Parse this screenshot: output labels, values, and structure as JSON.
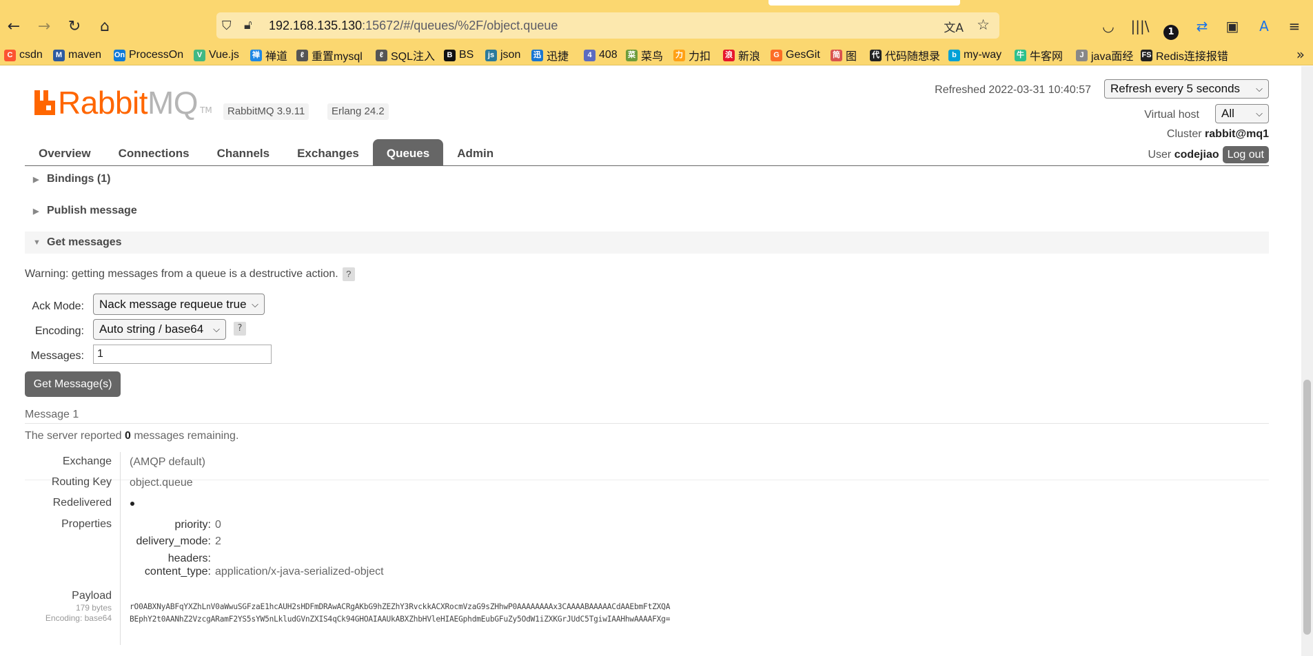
{
  "browser": {
    "url_host": "192.168.135.130",
    "url_rest": ":15672/#/queues/%2F/object.queue",
    "notification_count": "1"
  },
  "bookmarks": [
    {
      "label": "csdn",
      "color": "#fc5531",
      "glyph": "C"
    },
    {
      "label": "maven",
      "color": "#2c5aa0",
      "glyph": "M"
    },
    {
      "label": "ProcessOn",
      "color": "#0f7ad8",
      "glyph": "On"
    },
    {
      "label": "Vue.js",
      "color": "#41b883",
      "glyph": "V"
    },
    {
      "label": "禅道",
      "color": "#1e88e5",
      "glyph": "禅"
    },
    {
      "label": "重置mysql",
      "color": "#555555",
      "glyph": "ℓ"
    },
    {
      "label": "SQL注入",
      "color": "#555555",
      "glyph": "ℓ"
    },
    {
      "label": "BS",
      "color": "#111111",
      "glyph": "B"
    },
    {
      "label": "json",
      "color": "#2b7a9b",
      "glyph": "js"
    },
    {
      "label": "迅捷",
      "color": "#1976d2",
      "glyph": "迅"
    },
    {
      "label": "408",
      "color": "#5c6bc0",
      "glyph": "4"
    },
    {
      "label": "菜鸟",
      "color": "#6d9c3b",
      "glyph": "菜"
    },
    {
      "label": "力扣",
      "color": "#ffa116",
      "glyph": "力"
    },
    {
      "label": "新浪",
      "color": "#e6162d",
      "glyph": "浪"
    },
    {
      "label": "GesGit",
      "color": "#fc6d26",
      "glyph": "G"
    },
    {
      "label": "图",
      "color": "#d9534f",
      "glyph": "简"
    },
    {
      "label": "代码随想录",
      "color": "#222222",
      "glyph": "代"
    },
    {
      "label": "my-way",
      "color": "#00a1d6",
      "glyph": "b"
    },
    {
      "label": "牛客网",
      "color": "#2dc08d",
      "glyph": "牛"
    },
    {
      "label": "java面经",
      "color": "#888888",
      "glyph": "J"
    },
    {
      "label": "Redis连接报错",
      "color": "#222222",
      "glyph": "FS"
    }
  ],
  "header": {
    "logo_rabbit": "Rabbit",
    "logo_mq": "MQ",
    "logo_tm": "TM",
    "version": "RabbitMQ 3.9.11",
    "erlang": "Erlang 24.2",
    "refreshed_label": "Refreshed 2022-03-31 10:40:57",
    "refresh_option": "Refresh every 5 seconds",
    "vhost_label": "Virtual host",
    "vhost_value": "All",
    "cluster_label": "Cluster",
    "cluster_value": "rabbit@mq1",
    "user_label": "User",
    "user_value": "codejiao",
    "logout_label": "Log out"
  },
  "tabs": [
    {
      "label": "Overview",
      "active": false
    },
    {
      "label": "Connections",
      "active": false
    },
    {
      "label": "Channels",
      "active": false
    },
    {
      "label": "Exchanges",
      "active": false
    },
    {
      "label": "Queues",
      "active": true
    },
    {
      "label": "Admin",
      "active": false
    }
  ],
  "sections": {
    "bindings": "Bindings (1)",
    "publish": "Publish message",
    "get": "Get messages"
  },
  "get_messages": {
    "warning": "Warning: getting messages from a queue is a destructive action.",
    "help": "?",
    "ack_label": "Ack Mode:",
    "ack_value": "Nack message requeue true",
    "encoding_label": "Encoding:",
    "encoding_value": "Auto string / base64",
    "messages_label": "Messages:",
    "messages_value": "1",
    "button": "Get Message(s)"
  },
  "message": {
    "title": "Message 1",
    "remaining_prefix": "The server reported",
    "remaining_count": "0",
    "remaining_suffix": "messages remaining.",
    "exchange_label": "Exchange",
    "exchange_value": "(AMQP default)",
    "routing_label": "Routing Key",
    "routing_value": "object.queue",
    "redelivered_label": "Redelivered",
    "properties_label": "Properties",
    "properties": [
      {
        "key": "priority:",
        "value": "0"
      },
      {
        "key": "delivery_mode:",
        "value": "2"
      },
      {
        "key": "headers:",
        "value": ""
      },
      {
        "key": "content_type:",
        "value": "application/x-java-serialized-object"
      }
    ],
    "payload_label": "Payload",
    "payload_bytes": "179 bytes",
    "payload_encoding": "Encoding: base64",
    "payload_line1": "rO0ABXNyABFqYXZhLnV0aWwuSGFzaE1hcAUH2sHDFmDRAwACRgAKbG9hZEZhY3RvckkACXRocmVzaG9sZHhwP0AAAAAAAAx3CAAAABAAAAACdAAEbmFtZXQA",
    "payload_line2": "BEphY2t0AANhZ2VzcgARamF2YS5sYW5nLkludGVnZXIS4qCk94GHOAIAAUkABXZhbHVleHIAEGphdmEubGFuZy5OdW1iZXKGrJUdC5TgiwIAAHhwAAAAFXg="
  }
}
